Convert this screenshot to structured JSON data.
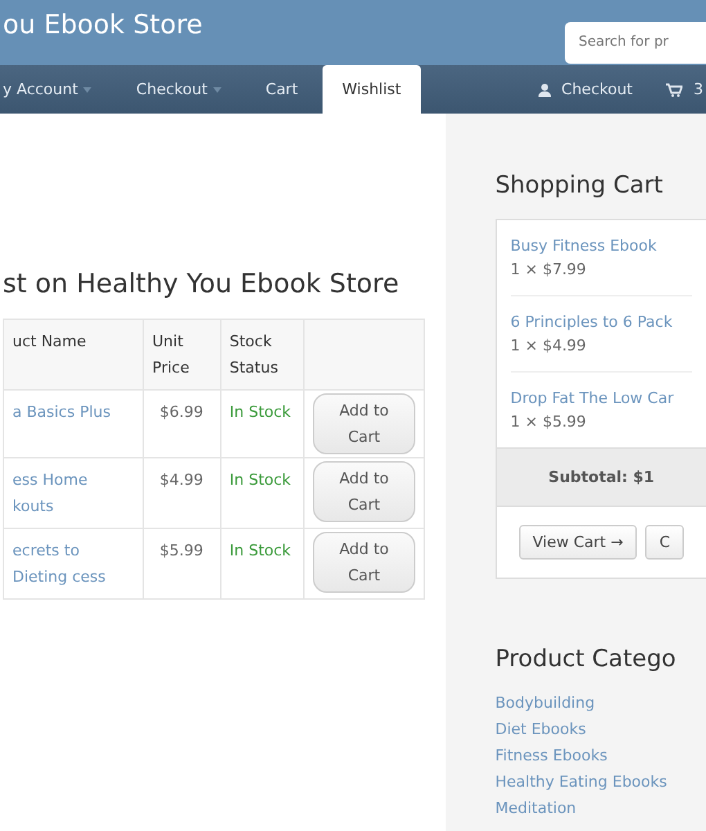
{
  "header": {
    "title": "ou Ebook Store",
    "search": {
      "placeholder": "Search for pr"
    }
  },
  "nav": {
    "tabs": [
      {
        "label": "y Account",
        "dropdown": true,
        "selected": false
      },
      {
        "label": "Checkout",
        "dropdown": true,
        "selected": false
      },
      {
        "label": "Cart",
        "dropdown": false,
        "selected": false
      },
      {
        "label": "Wishlist",
        "dropdown": false,
        "selected": true
      }
    ],
    "account_link": "Checkout",
    "cart_count": "3"
  },
  "wishlist": {
    "title": "st on Healthy You Ebook Store",
    "columns": [
      "uct Name",
      "Unit Price",
      "Stock Status"
    ],
    "rows": [
      {
        "name": "a Basics Plus",
        "price": "$6.99",
        "stock": "In Stock",
        "button": "Add to Cart"
      },
      {
        "name": "ess Home kouts",
        "price": "$4.99",
        "stock": "In Stock",
        "button": "Add to Cart"
      },
      {
        "name": "ecrets to Dieting cess",
        "price": "$5.99",
        "stock": "In Stock",
        "button": "Add to Cart"
      }
    ]
  },
  "cart": {
    "title": "Shopping Cart",
    "items": [
      {
        "name": "Busy Fitness Ebook",
        "qty": "1 × $7.99"
      },
      {
        "name": "6 Principles to 6 Pack",
        "qty": "1 × $4.99"
      },
      {
        "name": "Drop Fat The Low Car",
        "qty": "1 × $5.99"
      }
    ],
    "subtotal": "Subtotal: $1",
    "buttons": [
      "View Cart →",
      "C"
    ]
  },
  "categories": {
    "title": "Product Catego",
    "items": [
      "Bodybuilding",
      "Diet Ebooks",
      "Fitness Ebooks",
      "Healthy Eating Ebooks",
      "Meditation"
    ]
  }
}
